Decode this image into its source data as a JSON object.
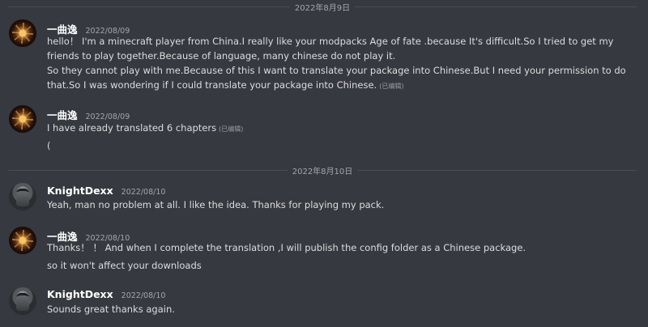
{
  "dividers": [
    "2022年8月9日",
    "2022年8月10日"
  ],
  "edited_label": "(已编辑)",
  "messages": [
    {
      "author": "一曲逸",
      "timestamp": "2022/08/09",
      "lines": [
        "hello！ I'm a minecraft player from China.I really like your modpacks Age of fate .because It's difficult.So I tried to get my",
        "friends to play together.Because of language, many chinese do not play it.",
        "So they cannot play with me.Because of this I want to translate your package into Chinese.But I need your permission to do",
        "that.So I was wondering if I could translate your package into Chinese."
      ]
    },
    {
      "author": "一曲逸",
      "timestamp": "2022/08/09",
      "lines": [
        "I have already translated 6 chapters",
        "("
      ]
    },
    {
      "author": "KnightDexx",
      "timestamp": "2022/08/10",
      "lines": [
        "Yeah, man no problem at all. I like the idea. Thanks for playing my pack."
      ]
    },
    {
      "author": "一曲逸",
      "timestamp": "2022/08/10",
      "lines": [
        "Thanks！ ！ And when I complete the translation ,I will publish the config folder as a Chinese package.",
        "so it won't affect your downloads"
      ]
    },
    {
      "author": "KnightDexx",
      "timestamp": "2022/08/10",
      "lines": [
        "Sounds great thanks again."
      ]
    }
  ]
}
